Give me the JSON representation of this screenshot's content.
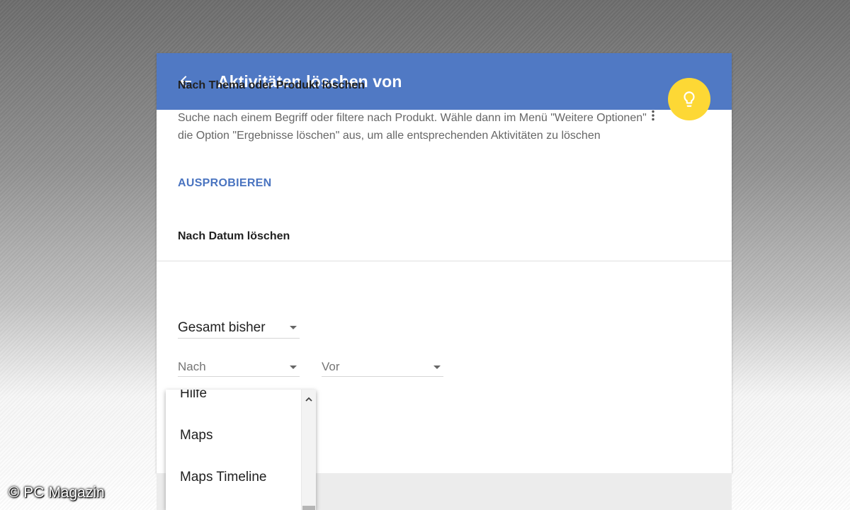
{
  "header": {
    "back_icon": "arrow-back-icon",
    "title": "Aktivitäten löschen von",
    "color": "#5079c4"
  },
  "topic_section": {
    "title": "Nach Thema oder Produkt löschen",
    "description_part1": "Suche nach einem Begriff oder filtere nach Produkt. Wähle dann im Menü \"Weitere Optionen\"",
    "more_icon": "more-vert-icon",
    "description_part2": "die Option \"Ergebnisse löschen\" aus, um alle entsprechenden Aktivitäten zu löschen",
    "try_label": "AUSPROBIEREN",
    "bulb_icon": "lightbulb-icon",
    "bulb_color": "#fdd835"
  },
  "date_section": {
    "title": "Nach Datum löschen",
    "range_value": "Gesamt bisher",
    "after_placeholder": "Nach",
    "before_placeholder": "Vor"
  },
  "product_dropdown": {
    "items": [
      "Hilfe",
      "Maps",
      "Maps Timeline"
    ]
  },
  "watermark": "© PC Magazin"
}
